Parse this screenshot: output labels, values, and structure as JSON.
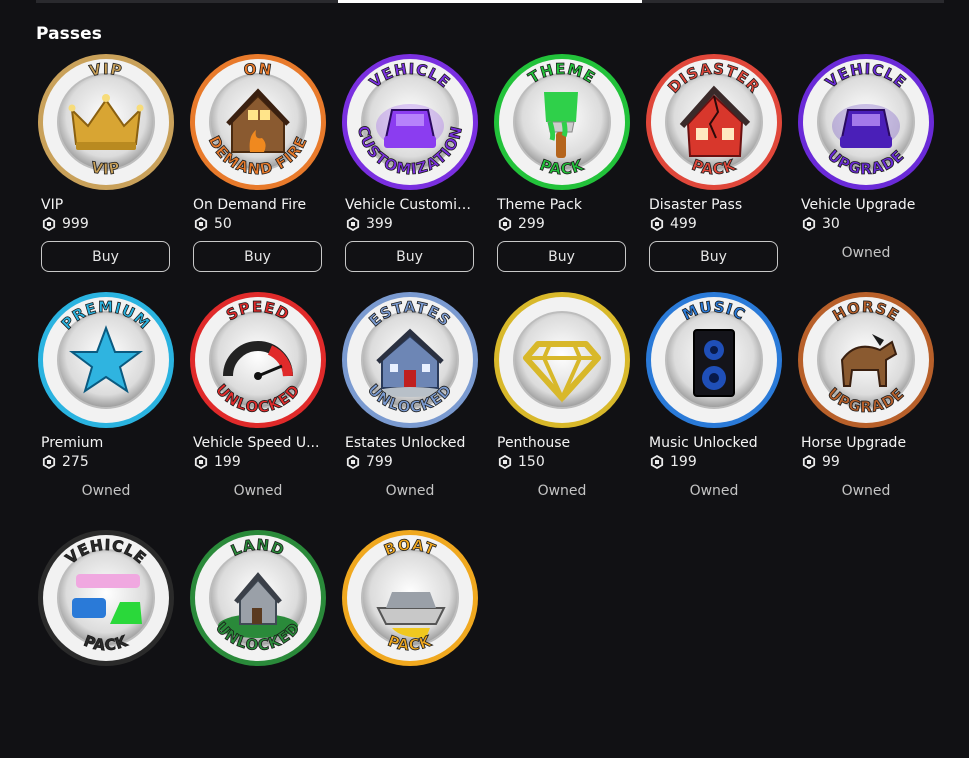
{
  "section": {
    "title": "Passes"
  },
  "colors": {
    "background": "#111114",
    "text": "#ffffff",
    "muted": "#c4c4c4"
  },
  "passes": [
    {
      "name": "VIP",
      "price": "999",
      "status": "buy",
      "action_label": "Buy",
      "badge_top": "VIP",
      "badge_bottom": "VIP",
      "ring": "#c9a15a",
      "art": "crown-icon",
      "art_color": "#d8a533"
    },
    {
      "name": "On Demand Fire",
      "price": "50",
      "status": "buy",
      "action_label": "Buy",
      "badge_top": "ON",
      "badge_bottom": "DEMAND FIRE",
      "ring": "#e87a2b",
      "art": "burning-house-icon",
      "art_color": "#f0891f"
    },
    {
      "name": "Vehicle Customiz...",
      "price": "399",
      "status": "buy",
      "action_label": "Buy",
      "badge_top": "VEHICLE",
      "badge_bottom": "CUSTOMIZATION",
      "ring": "#7a2fe0",
      "art": "car-icon",
      "art_color": "#8b3df0"
    },
    {
      "name": "Theme Pack",
      "price": "299",
      "status": "buy",
      "action_label": "Buy",
      "badge_top": "THEME",
      "badge_bottom": "PACK",
      "ring": "#22c23a",
      "art": "paintbrush-icon",
      "art_color": "#2fd04a"
    },
    {
      "name": "Disaster Pass",
      "price": "499",
      "status": "buy",
      "action_label": "Buy",
      "badge_top": "DISASTER",
      "badge_bottom": "PACK",
      "ring": "#e0473a",
      "art": "broken-house-icon",
      "art_color": "#d8372c"
    },
    {
      "name": "Vehicle Upgrade",
      "price": "30",
      "status": "owned",
      "action_label": "Owned",
      "badge_top": "VEHICLE",
      "badge_bottom": "UPGRADE",
      "ring": "#6a2ad8",
      "art": "car-icon",
      "art_color": "#4a1fb8"
    },
    {
      "name": "Premium",
      "price": "275",
      "status": "owned",
      "action_label": "Owned",
      "badge_top": "PREMIUM",
      "badge_bottom": "",
      "ring": "#2ab3e0",
      "art": "star-icon",
      "art_color": "#2fb4e0"
    },
    {
      "name": "Vehicle Speed U...",
      "price": "199",
      "status": "owned",
      "action_label": "Owned",
      "badge_top": "SPEED",
      "badge_bottom": "UNLOCKED",
      "ring": "#e02a2a",
      "art": "speedometer-icon",
      "art_color": "#e02a2a"
    },
    {
      "name": "Estates Unlocked",
      "price": "799",
      "status": "owned",
      "action_label": "Owned",
      "badge_top": "ESTATES",
      "badge_bottom": "UNLOCKED",
      "ring": "#7a9ad0",
      "art": "mansion-icon",
      "art_color": "#6d86b5"
    },
    {
      "name": "Penthouse",
      "price": "150",
      "status": "owned",
      "action_label": "Owned",
      "badge_top": "",
      "badge_bottom": "",
      "ring": "#d8b82a",
      "art": "diamond-icon",
      "art_color": "#d8b82a"
    },
    {
      "name": "Music Unlocked",
      "price": "199",
      "status": "owned",
      "action_label": "Owned",
      "badge_top": "MUSIC",
      "badge_bottom": "",
      "ring": "#2a7ad8",
      "art": "speaker-icon",
      "art_color": "#1f4fb8"
    },
    {
      "name": "Horse Upgrade",
      "price": "99",
      "status": "owned",
      "action_label": "Owned",
      "badge_top": "HORSE",
      "badge_bottom": "UPGRADE",
      "ring": "#b8602a",
      "art": "horse-icon",
      "art_color": "#8a5a30"
    },
    {
      "name": "",
      "price": "",
      "status": "none",
      "action_label": "",
      "badge_top": "VEHICLE",
      "badge_bottom": "PACK",
      "ring": "#2a2a2a",
      "art": "vehicles-icon",
      "art_color": "#2a7ad8"
    },
    {
      "name": "",
      "price": "",
      "status": "none",
      "action_label": "",
      "badge_top": "LAND",
      "badge_bottom": "UNLOCKED",
      "ring": "#2a8a3a",
      "art": "house-on-land-icon",
      "art_color": "#2a8a3a"
    },
    {
      "name": "",
      "price": "",
      "status": "none",
      "action_label": "",
      "badge_top": "BOAT",
      "badge_bottom": "PACK",
      "ring": "#f0a81f",
      "art": "boat-icon",
      "art_color": "#f0c81f"
    }
  ]
}
